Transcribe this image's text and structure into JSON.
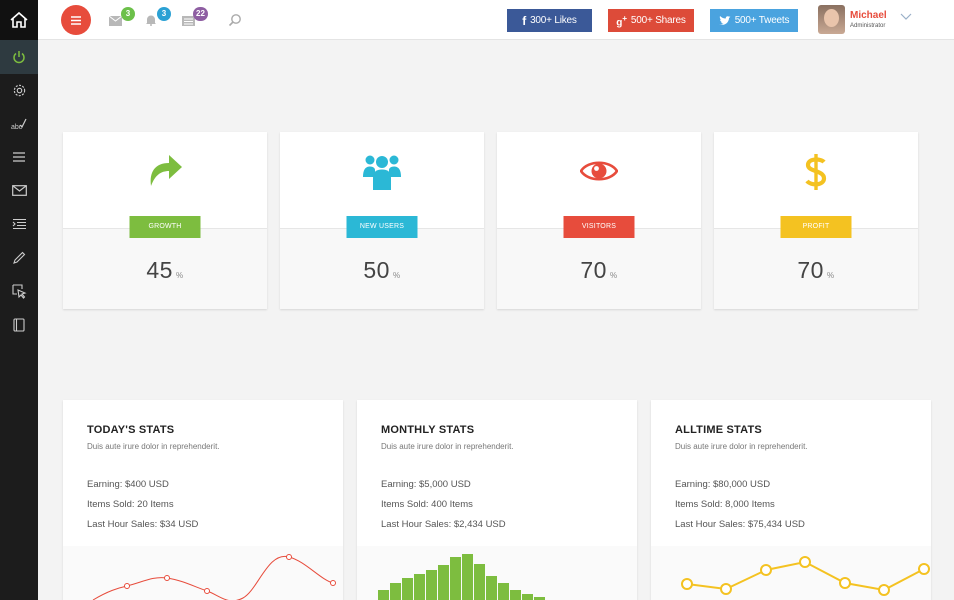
{
  "header": {
    "notifications": [
      {
        "name": "mail",
        "count": "3",
        "color": "#6cc04a"
      },
      {
        "name": "bell",
        "count": "3",
        "color": "#2ba1d4"
      },
      {
        "name": "list",
        "count": "22",
        "color": "#8e5ea2"
      }
    ],
    "social": {
      "facebook_label": "300+ Likes",
      "google_label": "500+ Shares",
      "twitter_label": "500+ Tweets"
    },
    "user": {
      "name": "Michael",
      "role": "Administrator"
    }
  },
  "sidebar": {
    "items": [
      "home-icon",
      "power-icon",
      "gear-icon",
      "spellcheck-icon",
      "menu-lines-icon",
      "envelope-icon",
      "list-icon",
      "pencil-icon",
      "cursor-icon",
      "book-icon"
    ]
  },
  "stats": [
    {
      "label": "GROWTH",
      "value": "45",
      "unit": "%",
      "color": "#7dbd3f",
      "icon": "share-arrow-icon"
    },
    {
      "label": "NEW USERS",
      "value": "50",
      "unit": "%",
      "color": "#2bb8d6",
      "icon": "users-icon"
    },
    {
      "label": "VISITORS",
      "value": "70",
      "unit": "%",
      "color": "#e74c3c",
      "icon": "eye-icon"
    },
    {
      "label": "PROFIT",
      "value": "70",
      "unit": "%",
      "color": "#f4c221",
      "icon": "dollar-icon"
    }
  ],
  "periods": [
    {
      "title": "TODAY'S STATS",
      "subtitle": "Duis aute irure dolor in reprehenderit.",
      "earning": "Earning: $400 USD",
      "items_sold": "Items Sold: 20 Items",
      "last_hour": "Last Hour Sales: $34 USD",
      "chart_color": "#e74c3c"
    },
    {
      "title": "MONTHLY STATS",
      "subtitle": "Duis aute irure dolor in reprehenderit.",
      "earning": "Earning: $5,000 USD",
      "items_sold": "Items Sold: 400 Items",
      "last_hour": "Last Hour Sales: $2,434 USD",
      "chart_color": "#7dbd3f"
    },
    {
      "title": "ALLTIME STATS",
      "subtitle": "Duis aute irure dolor in reprehenderit.",
      "earning": "Earning: $80,000 USD",
      "items_sold": "Items Sold: 8,000 Items",
      "last_hour": "Last Hour Sales: $75,434 USD",
      "chart_color": "#f4c221"
    }
  ]
}
